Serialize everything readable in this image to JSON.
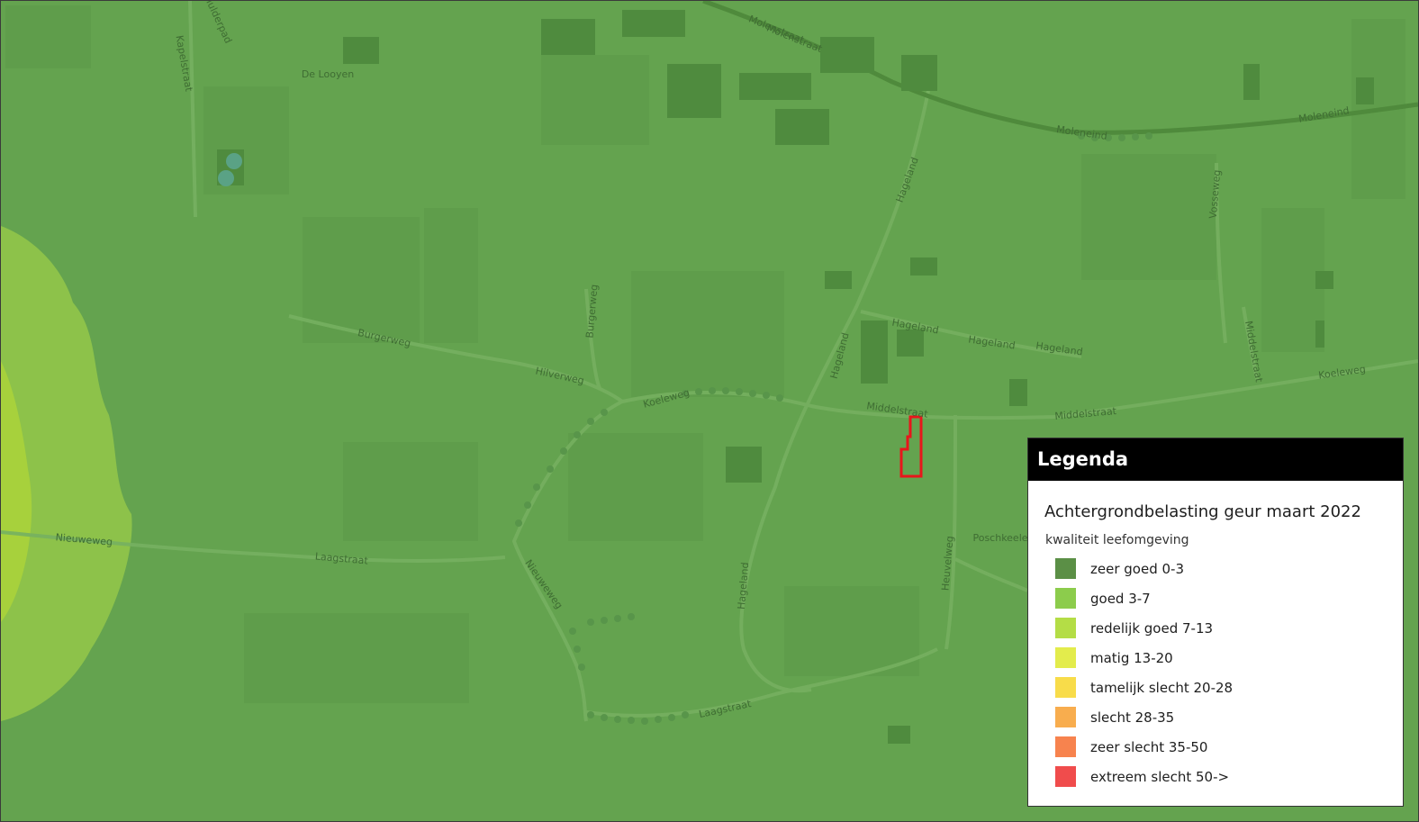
{
  "map": {
    "road_labels": [
      "Molenstraat",
      "Molenstraat",
      "Moleneind",
      "Moleneind",
      "Hulderpad",
      "Kapelstraat",
      "De Looyen",
      "Hageland",
      "Hageland",
      "Hageland",
      "Hageland",
      "Hageland",
      "Hageland",
      "Heuvelweg",
      "Vosseweg",
      "Burgerweg",
      "Burgerweg",
      "Hilverweg",
      "Middelstraat",
      "Middelstraat",
      "Middelstraat",
      "Koeleweg",
      "Koeleweg",
      "Nieuweweg",
      "Nieuweweg",
      "Laagstraat",
      "Laagstraat",
      "Poschkeele"
    ],
    "layers": {
      "base": "#64a34f",
      "goed": "#8dc24a",
      "redelijk_goed": "#a7d13c"
    },
    "plot_outline_color": "#e8161b"
  },
  "legend": {
    "header": "Legenda",
    "title": "Achtergrondbelasting geur maart 2022",
    "subtitle": "kwaliteit leefomgeving",
    "items": [
      {
        "label": "zeer goed 0-3",
        "color": "#5b8f46"
      },
      {
        "label": "goed 3-7",
        "color": "#8ccc4c"
      },
      {
        "label": "redelijk goed 7-13",
        "color": "#b4dd46"
      },
      {
        "label": "matig 13-20",
        "color": "#e3ec4c"
      },
      {
        "label": "tamelijk slecht 20-28",
        "color": "#f8dc4a"
      },
      {
        "label": "slecht 28-35",
        "color": "#f8ad4e"
      },
      {
        "label": "zeer slecht 35-50",
        "color": "#f7834e"
      },
      {
        "label": "extreem slecht 50->",
        "color": "#f04c4c"
      }
    ]
  }
}
